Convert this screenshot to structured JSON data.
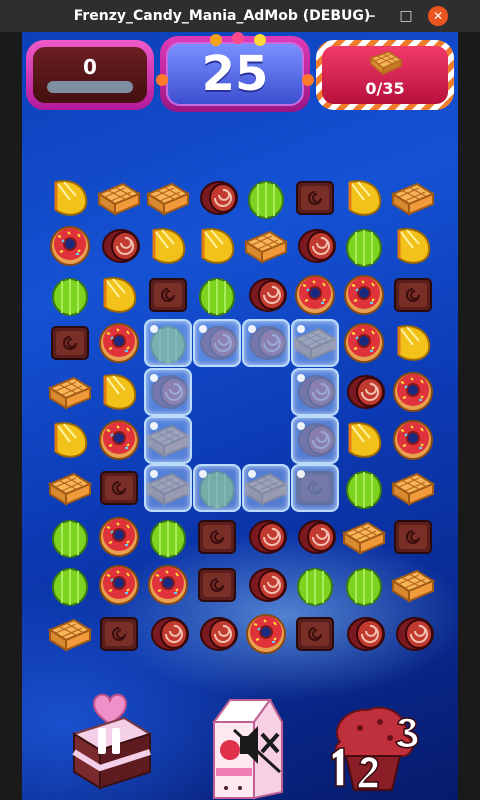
{
  "window": {
    "title": "Frenzy_Candy_Mania_AdMob (DEBUG)",
    "min_glyph": "–",
    "max_glyph": "□",
    "close_glyph": "✕",
    "close_color": "#e95420"
  },
  "hud": {
    "score": "0",
    "moves": "25",
    "goal_progress": "0/35",
    "goal_icon": "waffle-icon"
  },
  "board": {
    "columns": 8,
    "rows": 10,
    "legend": {
      "O": "orange-jelly-icon",
      "W": "waffle-icon",
      "R": "swiss-roll-icon",
      "G": "green-jelly-icon",
      "C": "chocolate-icon",
      "D": "donut-icon",
      ".": "empty"
    },
    "grid": [
      "OWWRGCOW",
      "DRLOWRGO",
      "GOCGRDDC",
      "CDgrrwDO",
      "WOr..rRD",
      "ODw..rOD",
      "WCwgwcGW",
      "GDGCRRWC",
      "GDDCRGGW",
      "WCRRDCRR"
    ],
    "frozen_legend_note": "lowercase letters are candies under ice; L is an orange jelly",
    "colors": {
      "orange_jelly": "#f2c21a",
      "green_jelly": "#7ed321",
      "waffle": "#f09a3c",
      "swiss_roll": "#c03a30",
      "chocolate": "#5a1e1c",
      "donut": "#e0323a",
      "ice": "#aad2ff"
    }
  },
  "buttons": {
    "pause": "pause-button",
    "sound": "sound-muted-button",
    "level": "level-select-button"
  }
}
